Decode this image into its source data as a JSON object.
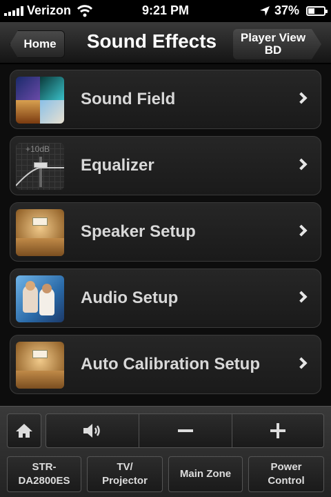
{
  "status_bar": {
    "carrier": "Verizon",
    "time": "9:21 PM",
    "battery_percent": "37%",
    "battery_level": 0.37,
    "icons": [
      "signal-bars-icon",
      "wifi-icon",
      "location-arrow-icon",
      "battery-icon"
    ]
  },
  "nav_bar": {
    "back_label": "Home",
    "title": "Sound Effects",
    "player_view_line1": "Player View",
    "player_view_line2": "BD"
  },
  "menu": {
    "items": [
      {
        "label": "Sound Field",
        "thumbnail": "sound-field-collage"
      },
      {
        "label": "Equalizer",
        "thumbnail": "equalizer-slider"
      },
      {
        "label": "Speaker Setup",
        "thumbnail": "speaker-room"
      },
      {
        "label": "Audio Setup",
        "thumbnail": "couple-on-couch"
      },
      {
        "label": "Auto Calibration Setup",
        "thumbnail": "calibration-room"
      }
    ],
    "equalizer_thumb_text": "+10dB"
  },
  "controls": {
    "home_icon": "home-icon",
    "volume_icon": "speaker-volume-icon",
    "minus_icon": "minus-icon",
    "plus_icon": "plus-icon",
    "zones": [
      {
        "line1": "STR-",
        "line2": "DA2800ES"
      },
      {
        "line1": "TV/",
        "line2": "Projector"
      },
      {
        "line1": "Main Zone",
        "line2": ""
      },
      {
        "line1": "Power",
        "line2": "Control"
      }
    ]
  }
}
